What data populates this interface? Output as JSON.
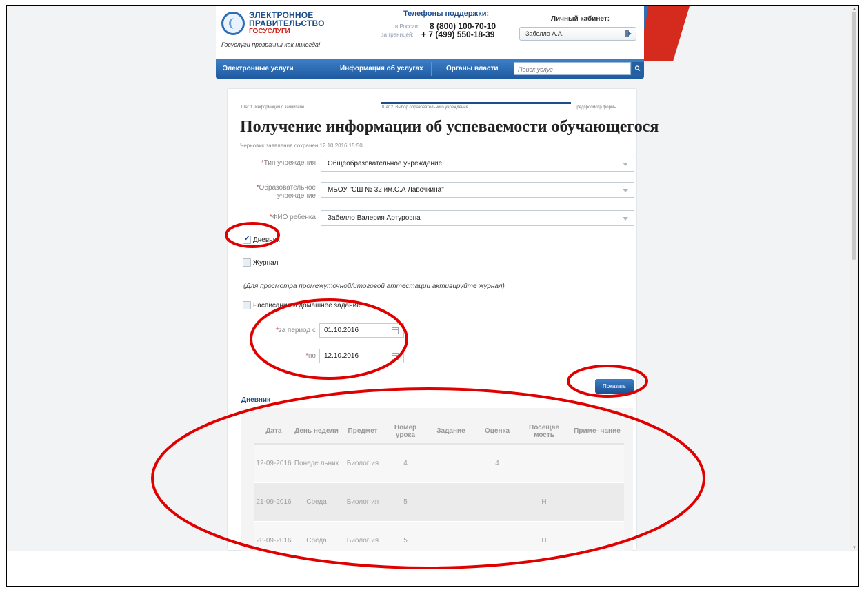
{
  "header": {
    "logo_line1": "ЭЛЕКТРОННОЕ",
    "logo_line2": "ПРАВИТЕЛЬСТВО",
    "logo_line3": "ГОСУСЛУГИ",
    "slogan": "Госуслуги прозрачны как никогда!",
    "support_title": "Телефоны поддержки:",
    "support_russia_label": "в России:",
    "support_russia_number": "8 (800) 100-70-10",
    "support_abroad_label": "за границей:",
    "support_abroad_number": "+ 7 (499) 550-18-39",
    "cabinet_title": "Личный кабинет:",
    "cabinet_user": "Забелло А.А."
  },
  "nav": {
    "items": [
      "Электронные услуги",
      "Информация об услугах",
      "Органы власти"
    ],
    "search_placeholder": "Поиск услуг"
  },
  "steps": [
    "Шаг 1. Информация о заявителе",
    "Шаг 2. Выбор образовательного учреждения",
    "Предпросмотр формы"
  ],
  "page_title": "Получение информации об успеваемости обучающегося",
  "draft_note": "Черновик заявления сохранен 12.10.2016 15:50",
  "form": {
    "institution_type_label": "Тип учреждения",
    "institution_type_value": "Общеобразовательное учреждение",
    "institution_label_1": "Образовательное",
    "institution_label_2": "учреждение",
    "institution_value": "МБОУ \"СШ № 32 им.С.А Лавочкина\"",
    "child_label": "ФИО ребенка",
    "child_value": "Забелло Валерия Артуровна",
    "diary_label": "Дневник",
    "diary_checked": true,
    "journal_label": "Журнал",
    "journal_checked": false,
    "journal_hint": "(Для просмотра промежуточной/итоговой аттестации активируйте журнал)",
    "schedule_label": "Расписание и домашнее задание",
    "schedule_checked": false,
    "period_from_label": "за период с",
    "period_from_value": "01.10.2016",
    "period_to_label": "по",
    "period_to_value": "12.10.2016",
    "show_button": "Показать"
  },
  "diary": {
    "section_title": "Дневник",
    "columns": [
      "Дата",
      "День недели",
      "Предмет",
      "Номер урока",
      "Задание",
      "Оценка",
      "Посещае мость",
      "Приме- чание"
    ],
    "rows": [
      [
        "12-09-2016",
        "Понеде льник",
        "Биолог ия",
        "4",
        "",
        "4",
        "",
        ""
      ],
      [
        "21-09-2016",
        "Среда",
        "Биолог ия",
        "5",
        "",
        "",
        "Н",
        ""
      ],
      [
        "28-09-2016",
        "Среда",
        "Биолог ия",
        "5",
        "",
        "",
        "Н",
        ""
      ]
    ]
  },
  "colors": {
    "brand_blue": "#1d4e8c",
    "nav_blue": "#2e6fb3",
    "annotation_red": "#e00000"
  }
}
